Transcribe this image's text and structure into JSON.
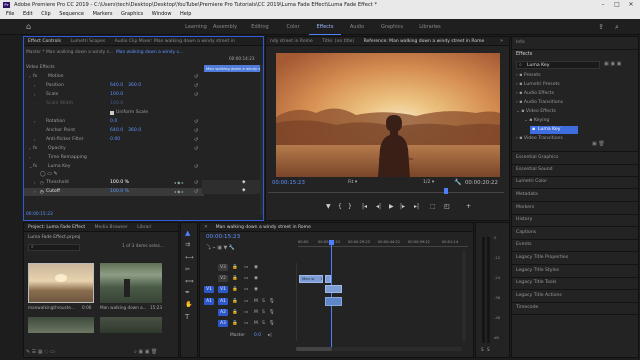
{
  "window": {
    "title": "Adobe Premiere Pro CC 2019 - C:\\Users\\tech\\Desktop\\Desktop\\YouTube\\Premiere Pro Tutorials\\CC 2019\\Luma Fade Effect\\Luma Fade Effect *",
    "logo": "Pr"
  },
  "menu": [
    "File",
    "Edit",
    "Clip",
    "Sequence",
    "Markers",
    "Graphics",
    "Window",
    "Help"
  ],
  "workspaces": [
    "Learning",
    "Assembly",
    "Editing",
    "Color",
    "Effects",
    "Audio",
    "Graphics",
    "Libraries"
  ],
  "active_workspace": "Effects",
  "source_tabs": [
    "Effect Controls",
    "Lumetri Scopes",
    "Audio Clip Mixer: Man walking down a windy street in"
  ],
  "program_tabs": [
    "ndy street in Rome",
    "Title: (no title)",
    "Reference: Man walking down a windy street in Rome"
  ],
  "effect_controls": {
    "master": "Master * Man walking down a windy s...",
    "clip_ref": "Man walking down a windy s...",
    "timecode_top": "00:00:14:23",
    "clip_bar": "Man walking down a windy street in Rom",
    "section": "Video Effects",
    "rows": [
      {
        "label": "Motion",
        "kind": "group"
      },
      {
        "label": "Position",
        "v1": "640.0",
        "v2": "360.0"
      },
      {
        "label": "Scale",
        "v1": "100.0"
      },
      {
        "label": "Scale Width",
        "v1": "100.0",
        "dim": true
      },
      {
        "label": "Uniform Scale",
        "kind": "check"
      },
      {
        "label": "Rotation",
        "v1": "0.0"
      },
      {
        "label": "Anchor Point",
        "v1": "640.0",
        "v2": "360.0"
      },
      {
        "label": "Anti-flicker Filter",
        "v1": "0.00"
      },
      {
        "label": "Opacity",
        "kind": "group"
      },
      {
        "label": "Time Remapping",
        "kind": "group"
      },
      {
        "label": "Luma Key",
        "kind": "group"
      },
      {
        "label": "Threshold",
        "v1": "100.0 %"
      },
      {
        "label": "Cutoff",
        "v1": "100.0 %"
      }
    ],
    "timecode_bottom": "00:00:15:23"
  },
  "program": {
    "timecode_left": "00:00:15:23",
    "fit": "Fit",
    "quality": "1/2",
    "timecode_right": "00:00:20:22"
  },
  "effects_panel": {
    "tabs": [
      "Info",
      "Effects"
    ],
    "search": "Luma Key",
    "tree": [
      {
        "label": "Presets",
        "depth": 0
      },
      {
        "label": "Lumetri Presets",
        "depth": 0
      },
      {
        "label": "Audio Effects",
        "depth": 0
      },
      {
        "label": "Audio Transitions",
        "depth": 0
      },
      {
        "label": "Video Effects",
        "depth": 0
      },
      {
        "label": "Keying",
        "depth": 1
      },
      {
        "label": "Luma Key",
        "depth": 2,
        "selected": true
      },
      {
        "label": "Video Transitions",
        "depth": 0
      }
    ],
    "stack": [
      "Essential Graphics",
      "Essential Sound",
      "Lumetri Color",
      "Metadata",
      "Markers",
      "History",
      "Captions",
      "Events",
      "Legacy Title Properties",
      "Legacy Title Styles",
      "Legacy Title Tools",
      "Legacy Title Actions",
      "Timecode"
    ]
  },
  "project": {
    "tabs": [
      "Project: Luma Fade Effect",
      "Media Browser",
      "Librari"
    ],
    "path": "Luma Fade Effect.prproj",
    "count": "1 of 3 items selec...",
    "items": [
      {
        "name": "manwalkingthrouste...",
        "duration": "0:06"
      },
      {
        "name": "Man walking down a...",
        "duration": "15:23"
      }
    ]
  },
  "timeline": {
    "tab": "Man walking down a windy street in Rome",
    "timecode": "00:00:15:23",
    "ruler": [
      "00:00",
      "00:00:14:23",
      "00:00:29:23",
      "00:00:44:22",
      "00:00:59:22",
      "00:01:14"
    ],
    "video_tracks": [
      "V3",
      "V2",
      "V1"
    ],
    "audio_tracks": [
      "A1",
      "A2",
      "A3"
    ],
    "sources": {
      "video": "V1",
      "audio": "A1"
    },
    "master": {
      "label": "Master",
      "value": "0.0"
    },
    "clip_label": "Man w"
  },
  "meters": {
    "labels": [
      "0",
      "-12",
      "-24",
      "-36",
      "-48",
      "dB"
    ],
    "solo": "S"
  },
  "colors": {
    "accent": "#4f7ffc",
    "panel_focus": "#2f5bd6",
    "clip_video": "#7e9dd5",
    "clip_audio": "#5f86c9"
  }
}
